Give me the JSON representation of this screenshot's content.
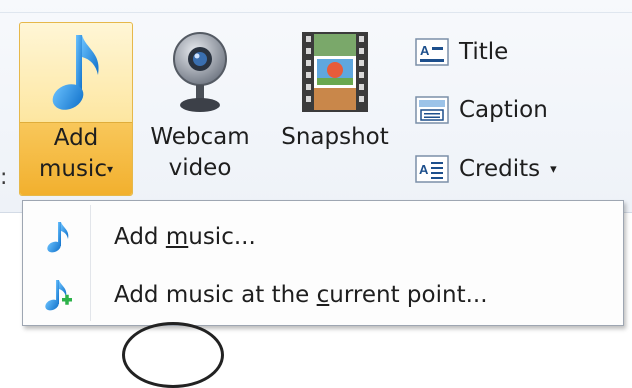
{
  "ribbon": {
    "add_music": {
      "line1": "Add",
      "line2": "music",
      "arrow": "▾",
      "icon": "music-note-icon"
    },
    "webcam": {
      "line1": "Webcam",
      "line2": "video",
      "icon": "webcam-icon"
    },
    "snapshot": {
      "line1": "Snapshot",
      "icon": "snapshot-icon"
    },
    "title": {
      "label": "Title",
      "icon": "title-icon"
    },
    "caption": {
      "label": "Caption",
      "icon": "caption-icon"
    },
    "credits": {
      "label": "Credits",
      "arrow": "▾",
      "icon": "credits-icon"
    }
  },
  "menu": {
    "items": [
      {
        "pre": "Add ",
        "underline": "m",
        "post": "usic...",
        "icon": "music-note-icon"
      },
      {
        "pre": "Add music at the ",
        "underline": "c",
        "post": "urrent point...",
        "icon": "music-note-plus-icon"
      }
    ]
  },
  "colors": {
    "accent": "#f6cf5c",
    "note_blue": "#1f8fe0",
    "plus_green": "#2db24a"
  }
}
